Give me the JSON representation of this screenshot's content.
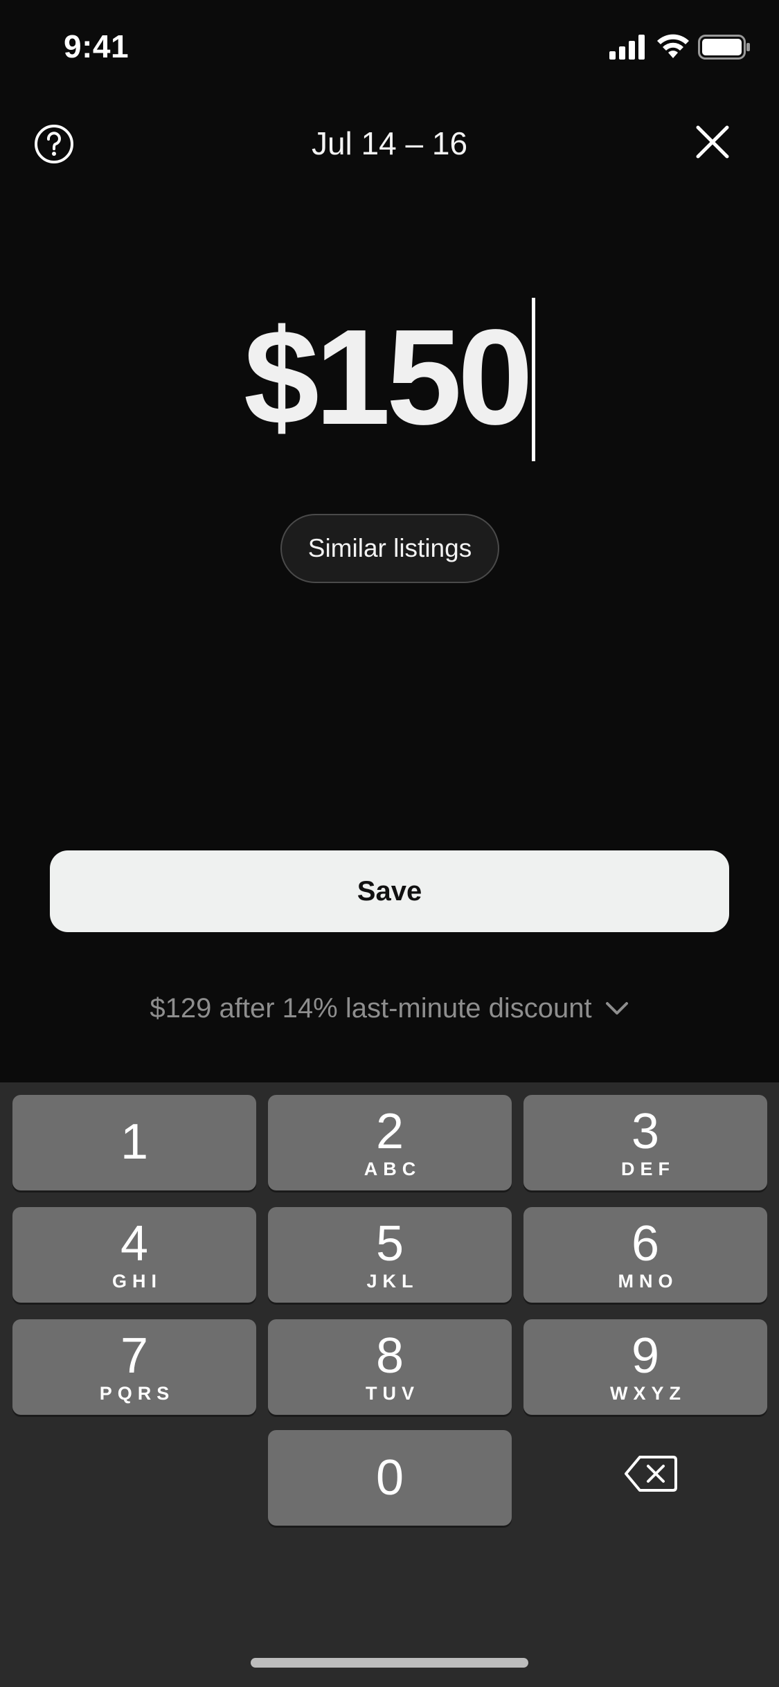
{
  "status_bar": {
    "time": "9:41"
  },
  "header": {
    "date_range": "Jul 14 – 16"
  },
  "price": {
    "value": "$150"
  },
  "similar_listings_label": "Similar listings",
  "save_label": "Save",
  "discount_text": "$129 after 14% last-minute discount",
  "keypad": {
    "keys": [
      {
        "digit": "1",
        "letters": ""
      },
      {
        "digit": "2",
        "letters": "ABC"
      },
      {
        "digit": "3",
        "letters": "DEF"
      },
      {
        "digit": "4",
        "letters": "GHI"
      },
      {
        "digit": "5",
        "letters": "JKL"
      },
      {
        "digit": "6",
        "letters": "MNO"
      },
      {
        "digit": "7",
        "letters": "PQRS"
      },
      {
        "digit": "8",
        "letters": "TUV"
      },
      {
        "digit": "9",
        "letters": "WXYZ"
      },
      {
        "digit": "0",
        "letters": ""
      }
    ]
  },
  "icons": {
    "help": "question-circle-icon",
    "close": "close-icon",
    "chevron": "chevron-down-icon",
    "backspace": "backspace-icon"
  },
  "colors": {
    "background": "#0b0b0b",
    "save_button_bg": "#eff1f0",
    "keypad_bg": "#2b2b2b",
    "key_bg": "#6e6e6e",
    "muted_text": "#8e8e8e"
  }
}
